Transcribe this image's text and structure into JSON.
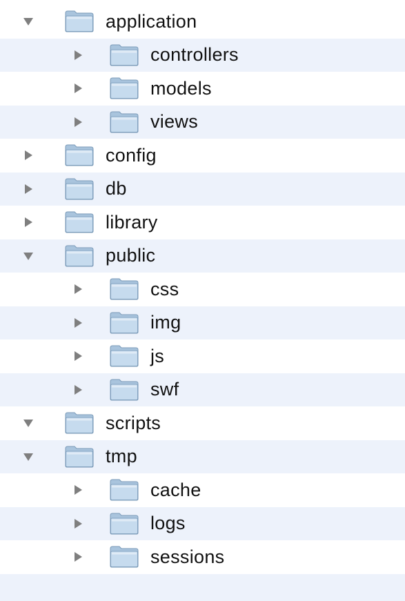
{
  "colors": {
    "alt_row": "#edf2fb",
    "triangle": "#7f7f7f",
    "folder_body": "#a9c4dd",
    "folder_front": "#c6dbee",
    "folder_edge": "#7a9ab8"
  },
  "tree": {
    "rows": [
      {
        "label": "application",
        "level": 0,
        "expanded": true,
        "icon": "folder-icon"
      },
      {
        "label": "controllers",
        "level": 1,
        "expanded": false,
        "icon": "folder-icon"
      },
      {
        "label": "models",
        "level": 1,
        "expanded": false,
        "icon": "folder-icon"
      },
      {
        "label": "views",
        "level": 1,
        "expanded": false,
        "icon": "folder-icon"
      },
      {
        "label": "config",
        "level": 0,
        "expanded": false,
        "icon": "folder-icon"
      },
      {
        "label": "db",
        "level": 0,
        "expanded": false,
        "icon": "folder-icon"
      },
      {
        "label": "library",
        "level": 0,
        "expanded": false,
        "icon": "folder-icon"
      },
      {
        "label": "public",
        "level": 0,
        "expanded": true,
        "icon": "folder-icon"
      },
      {
        "label": "css",
        "level": 1,
        "expanded": false,
        "icon": "folder-icon"
      },
      {
        "label": "img",
        "level": 1,
        "expanded": false,
        "icon": "folder-icon"
      },
      {
        "label": "js",
        "level": 1,
        "expanded": false,
        "icon": "folder-icon"
      },
      {
        "label": "swf",
        "level": 1,
        "expanded": false,
        "icon": "folder-icon"
      },
      {
        "label": "scripts",
        "level": 0,
        "expanded": true,
        "icon": "folder-icon"
      },
      {
        "label": "tmp",
        "level": 0,
        "expanded": true,
        "icon": "folder-icon"
      },
      {
        "label": "cache",
        "level": 1,
        "expanded": false,
        "icon": "folder-icon"
      },
      {
        "label": "logs",
        "level": 1,
        "expanded": false,
        "icon": "folder-icon"
      },
      {
        "label": "sessions",
        "level": 1,
        "expanded": false,
        "icon": "folder-icon"
      }
    ]
  }
}
